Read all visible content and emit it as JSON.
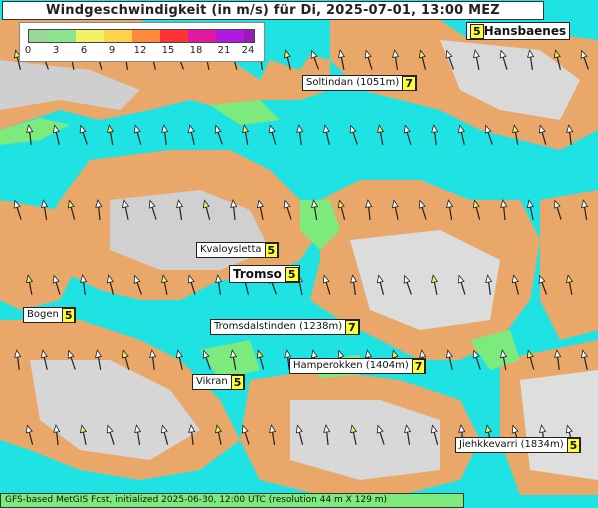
{
  "title": "Windgeschwindigkeit (in m/s) für Di, 2025-07-01, 13:00 MEZ",
  "legend": {
    "ticks": [
      "0",
      "3",
      "6",
      "9",
      "12",
      "15",
      "18",
      "21",
      "24"
    ],
    "colors": [
      "#9ad79a",
      "#8de58d",
      "#f2f266",
      "#ffd24a",
      "#ff8a3a",
      "#ff3333",
      "#e01aa0",
      "#b01ae0",
      "#9b1ab8"
    ]
  },
  "places": [
    {
      "name": "Hansbaenes",
      "value": "5"
    },
    {
      "name": "Soltindan (1051m)",
      "value": "7"
    },
    {
      "name": "Kvaloysletta",
      "value": "5"
    },
    {
      "name": "Tromso",
      "value": "5"
    },
    {
      "name": "Bogen",
      "value": "5"
    },
    {
      "name": "Tromsdalstinden (1238m)",
      "value": "7"
    },
    {
      "name": "Hamperokken (1404m)",
      "value": "7"
    },
    {
      "name": "Vikran",
      "value": "5"
    },
    {
      "name": "Jiehkkevarri (1834m)",
      "value": "5"
    }
  ],
  "footer": "GFS-based MetGIS Fcst, initialized 2025-06-30, 12:00 UTC  (resolution 44 m X 129 m)",
  "colors": {
    "sea": "#1fe3e3",
    "land_low": "#7dea7d",
    "land_mid": "#f3b27a",
    "snow": "#e8e8e8"
  }
}
